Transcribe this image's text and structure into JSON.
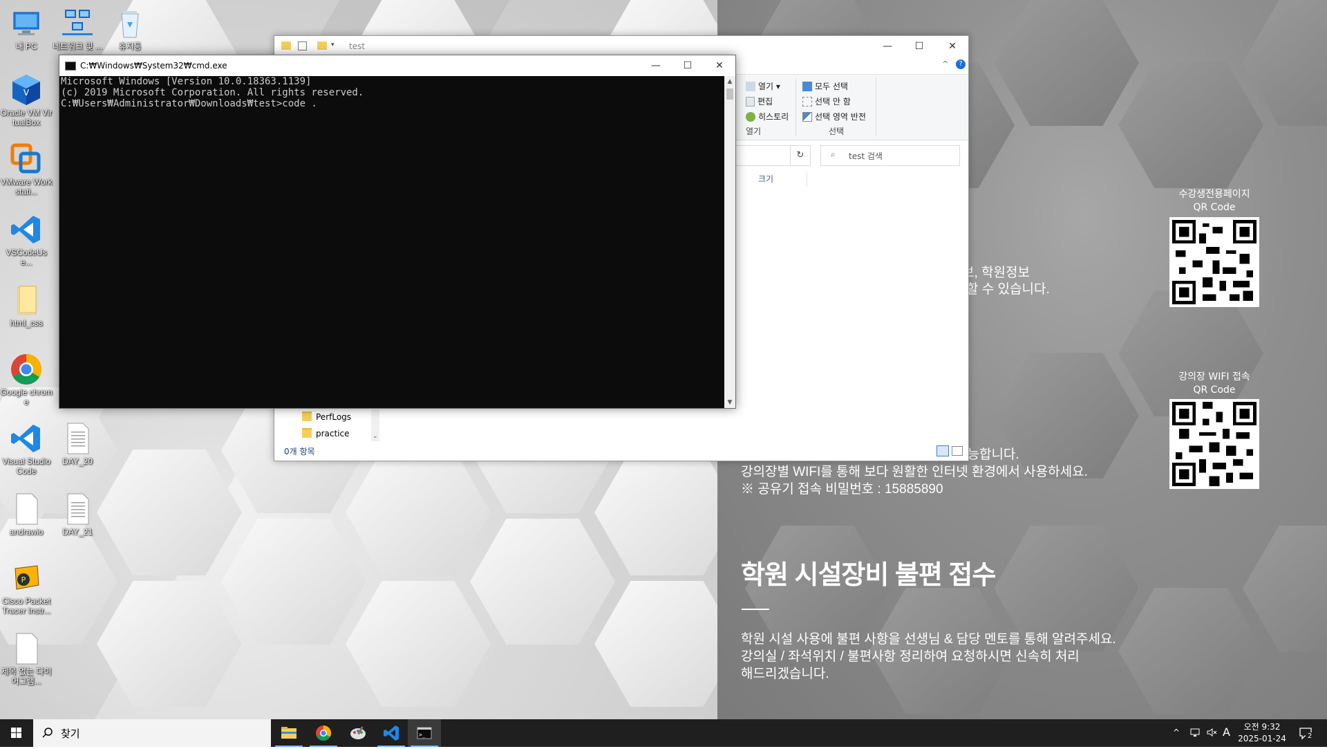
{
  "desktop": {
    "icons": [
      {
        "label": "내 PC",
        "icon": "computer-icon"
      },
      {
        "label": "네트워크 및 ...",
        "icon": "network-icon"
      },
      {
        "label": "휴지통",
        "icon": "recycle-bin-icon"
      },
      {
        "label": "Oracle VM VirtualBox",
        "icon": "virtualbox-icon"
      },
      {
        "label": "VMware Workstati...",
        "icon": "vmware-icon"
      },
      {
        "label": "VSCodeUse...",
        "icon": "vscode-icon"
      },
      {
        "label": "html_css",
        "icon": "folder-icon"
      },
      {
        "label": "Google chrome",
        "icon": "chrome-icon"
      },
      {
        "label": "Visual Studio Code",
        "icon": "vscode-icon"
      },
      {
        "label": "DAY_20",
        "icon": "document-icon"
      },
      {
        "label": "andrawio",
        "icon": "document-icon"
      },
      {
        "label": "DAY_21",
        "icon": "document-icon"
      },
      {
        "label": "Cisco Packet Tracer Instr...",
        "icon": "packet-tracer-icon"
      },
      {
        "label": "제목 없는 다이어그램...",
        "icon": "document-icon"
      }
    ]
  },
  "wallpaper": {
    "line1": "보, 학원정보",
    "line2": "할 수 있습니다.",
    "wifi_line1": "가능합니다.",
    "wifi_line2": "강의장별 WIFI를 통해 보다 원활한 인터넷 환경에서 사용하세요.",
    "wifi_line3": "※ 공유기 접속 비밀번호 : 15885890",
    "heading": "학원 시설장비 불편 접수",
    "body1": "학원 시설 사용에 불편 사항을 선생님 & 담당 멘토를 통해 알려주세요.",
    "body2": "강의실 / 좌석위치 / 불편사항 정리하여 요청하시면 신속히 처리",
    "body3": "해드리겠습니다.",
    "qr1_title": "수강생전용페이지",
    "qr1_sub": "QR Code",
    "qr2_title": "강의장 WIFI 접속",
    "qr2_sub": "QR Code"
  },
  "explorer": {
    "title": "test",
    "ribbon": {
      "open": "열기",
      "edit": "편집",
      "history": "히스토리",
      "select_all": "모두 선택",
      "select_none": "선택 안 함",
      "invert_selection": "선택 영역 반전",
      "group_open": "열기",
      "group_select": "선택"
    },
    "search_placeholder": "test 검색",
    "column_size": "크기",
    "nav": [
      "PerfLogs",
      "practice"
    ],
    "status": "0개 항목"
  },
  "cmd": {
    "title": "C:₩Windows₩System32₩cmd.exe",
    "lines": [
      "Microsoft Windows [Version 10.0.18363.1139]",
      "(c) 2019 Microsoft Corporation. All rights reserved.",
      "",
      "C:₩Users₩Administrator₩Downloads₩test>code ."
    ]
  },
  "taskbar": {
    "search_placeholder": "찾기",
    "apps": [
      "file-explorer-icon",
      "chrome-icon",
      "paint-icon",
      "vscode-icon",
      "cmd-icon"
    ],
    "ime": "A",
    "clock_time": "오전 9:32",
    "clock_date": "2025-01-24",
    "notifications": "2"
  }
}
